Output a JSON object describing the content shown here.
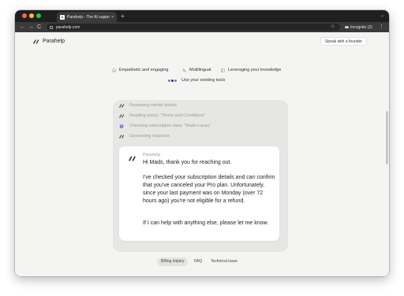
{
  "browser": {
    "tab_title": "Parahelp - The AI support ag",
    "tab_close": "×",
    "new_tab": "+",
    "tabstrip_menu": "⌄",
    "nav_back": "←",
    "nav_forward": "→",
    "nav_reload": "C",
    "url": "parahelp.com",
    "bookmark": "☆",
    "incognito_label": "Incognito (2)",
    "menu": "⋮"
  },
  "header": {
    "logo_text": "Parahelp",
    "cta_label": "Speak with a founder"
  },
  "features": {
    "items": [
      {
        "label": "Empathetic and engaging",
        "icon": "smile-icon"
      },
      {
        "label": "Multilingual",
        "icon": "translate-icon"
      },
      {
        "label": "Leveraging your knowledge",
        "icon": "book-icon"
      }
    ],
    "tools_label": "Use your existing tools"
  },
  "chat": {
    "steps": [
      {
        "label": "Reviewing similar tickets",
        "icon": "parahelp-logo-icon"
      },
      {
        "label": "Reading policy: \"Terms and Conditions\"",
        "icon": "parahelp-logo-icon"
      },
      {
        "label": "Checking subscription data: \"Mads Lunau\"",
        "icon": "stripe-icon"
      },
      {
        "label": "Generating response",
        "icon": "parahelp-logo-icon"
      }
    ],
    "reply": {
      "sender": "Parahelp",
      "paragraph_1": "Hi Mads, thank you for reaching out.",
      "paragraph_2": "I've checked your subscription details and can confirm that you've canceled your Pro plan. Unfortunately, since your last payment was on Monday (over 72 hours ago) you're not eligible for a refund.",
      "paragraph_3": "If I can help with anything else, please let me know."
    }
  },
  "examples": {
    "tabs": [
      "Billing inquiry",
      "FAQ",
      "Technical issue"
    ],
    "active": "Billing inquiry"
  },
  "colors": {
    "page_bg": "#f4f4f3",
    "card_bg": "#e6e6e4",
    "muted_text": "#9a9a9a",
    "accent_purple": "#6f6bd8"
  }
}
